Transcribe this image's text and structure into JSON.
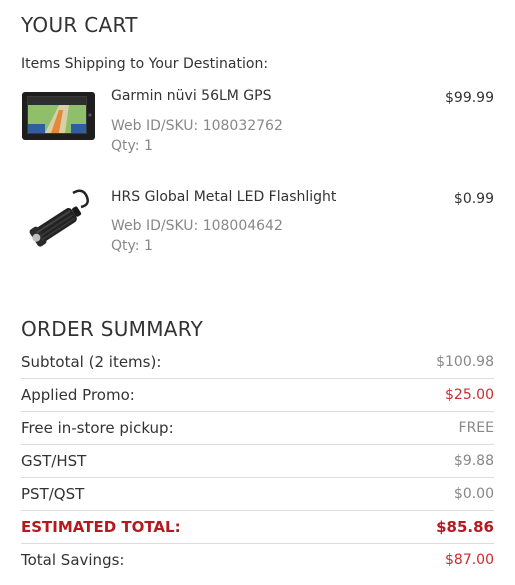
{
  "cart": {
    "title": "YOUR CART",
    "shipping_label": "Items Shipping to Your Destination:",
    "items": [
      {
        "name": "Garmin nüvi 56LM GPS",
        "sku": "Web ID/SKU: 108032762",
        "qty": "Qty: 1",
        "price": "$99.99",
        "image": "gps-device-icon"
      },
      {
        "name": "HRS Global Metal LED Flashlight",
        "sku": "Web ID/SKU: 108004642",
        "qty": "Qty: 1",
        "price": "$0.99",
        "image": "flashlight-icon"
      }
    ]
  },
  "summary": {
    "title": "ORDER SUMMARY",
    "rows": [
      {
        "label": "Subtotal (2 items):",
        "value": "$100.98"
      },
      {
        "label": "Applied Promo:",
        "value": "$25.00"
      },
      {
        "label": "Free in-store pickup:",
        "value": "FREE"
      },
      {
        "label": "GST/HST",
        "value": "$9.88"
      },
      {
        "label": "PST/QST",
        "value": "$0.00"
      },
      {
        "label": "ESTIMATED TOTAL:",
        "value": "$85.86"
      },
      {
        "label": "Total Savings:",
        "value": "$87.00"
      }
    ]
  },
  "colors": {
    "text": "#333333",
    "muted": "#888888",
    "promo_red": "#cc2b2b",
    "total_red": "#b3191f",
    "divider": "#dddddd"
  }
}
